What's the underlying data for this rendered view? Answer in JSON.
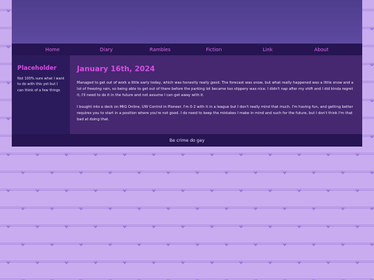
{
  "nav": {
    "items": [
      {
        "label": "Home"
      },
      {
        "label": "Diary"
      },
      {
        "label": "Rambles"
      },
      {
        "label": "Fiction"
      },
      {
        "label": "Link"
      },
      {
        "label": "About"
      }
    ]
  },
  "sidebar": {
    "title": "Placeholder",
    "text": "Not 100% sure what I want to do with this yet but I can think of a few things"
  },
  "post": {
    "date": "January 16th, 2024",
    "paragraphs": [
      "Managed to get out of work a little early today, which was honestly really good. The forecast was snow, but what really happened was a little snow and a lot of freezing rain, so being able to get out of there before the parking lot became too slippery was nice. I didn't nap after my shift and I did kinda regret it, I'll need to do it in the future and not assume I can get away with it.",
      "I bought into a deck on MtG Online, UW Control in Pioneer. I'm 0-2 with it in a league but I don't really mind that much, I'm having fun, and getting better requires you to start in a position where you're not good. I do need to keep the mistakes I make in mind and such for the future, but I don't think I'm that bad at doing that."
    ]
  },
  "footer": {
    "text": "Be crime do gay"
  },
  "colors": {
    "accent": "#d64fe4",
    "nav_bg": "#261552",
    "main_bg": "#452870",
    "sidebar_bg": "#2c1b5c",
    "page_bg": "#c8acef"
  }
}
